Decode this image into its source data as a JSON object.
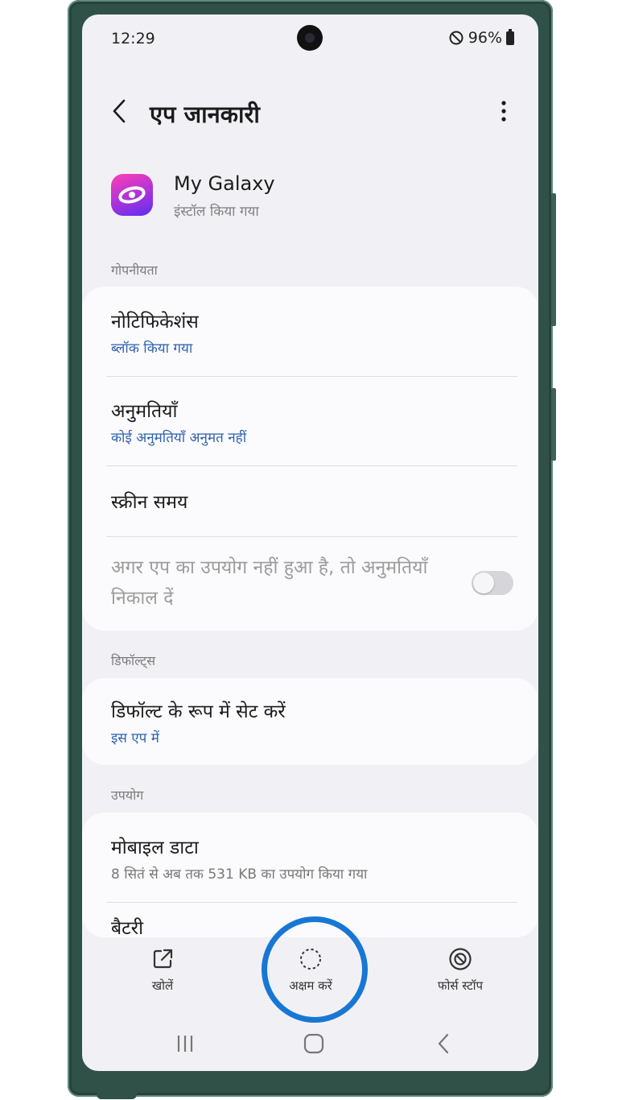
{
  "status_bar": {
    "time": "12:29",
    "battery_percent": "96%"
  },
  "header": {
    "title": "एप जानकारी"
  },
  "app": {
    "name": "My Galaxy",
    "status": "इंस्टॉल किया गया",
    "icon": "galaxy-swirl-icon"
  },
  "sections": {
    "privacy": {
      "label": "गोपनीयता",
      "notifications": {
        "title": "नोटिफिकेशंस",
        "subtitle": "ब्लॉक किया गया"
      },
      "permissions": {
        "title": "अनुमतियाँ",
        "subtitle": "कोई अनुमतियाँ अनुमत नहीं"
      },
      "screen_time": {
        "title": "स्क्रीन समय"
      },
      "remove_permissions": {
        "title": "अगर एप का उपयोग नहीं हुआ है, तो अनुमतियाँ निकाल दें",
        "enabled": false
      }
    },
    "defaults": {
      "label": "डिफॉल्ट्स",
      "set_as_default": {
        "title": "डिफॉल्ट के रूप में सेट करें",
        "subtitle": "इस एप में"
      }
    },
    "usage": {
      "label": "उपयोग",
      "mobile_data": {
        "title": "मोबाइल डाटा",
        "subtitle": "8 सितं से अब तक 531 KB का उपयोग किया गया"
      },
      "battery": {
        "title": "बैटरी"
      }
    }
  },
  "bottom_actions": {
    "open": {
      "label": "खोलें",
      "icon": "open-external-icon"
    },
    "disable": {
      "label": "अक्षम करें",
      "icon": "disable-dashed-circle-icon"
    },
    "force_stop": {
      "label": "फोर्स स्टॉप",
      "icon": "force-stop-icon"
    }
  },
  "colors": {
    "accent_link": "#2f62b0",
    "highlight_ring": "#1877d4",
    "frame": "#2f5148"
  }
}
